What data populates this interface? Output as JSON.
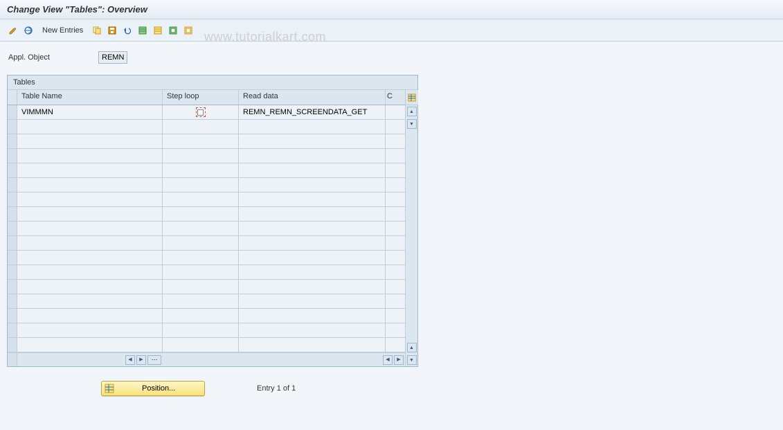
{
  "title": "Change View \"Tables\": Overview",
  "watermark": "www.tutorialkart.com",
  "toolbar": {
    "new_entries_label": "New Entries"
  },
  "field": {
    "label": "Appl. Object",
    "value": "REMN"
  },
  "table": {
    "title": "Tables",
    "columns": {
      "c1": "Table Name",
      "c2": "Step loop",
      "c3": "Read data",
      "c4": "C"
    },
    "rows": [
      {
        "table_name": "VIMMMN",
        "step_loop": false,
        "read_data": "REMN_REMN_SCREENDATA_GET"
      }
    ]
  },
  "footer": {
    "position_label": "Position...",
    "entry_text": "Entry 1 of 1"
  }
}
